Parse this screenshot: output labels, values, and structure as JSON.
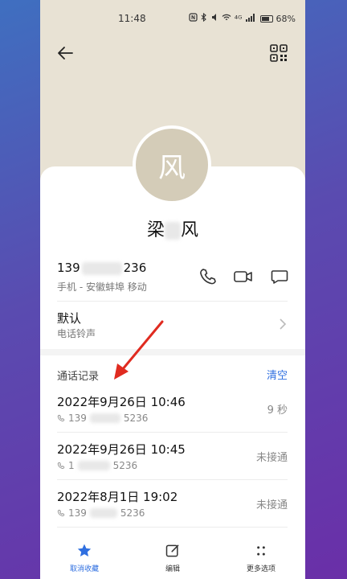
{
  "status_bar": {
    "time": "11:48",
    "signal_text": "⁴ᴳ",
    "battery": "68%"
  },
  "contact": {
    "avatar_letter": "风",
    "name_first": "梁",
    "name_last": "风"
  },
  "phone": {
    "prefix": "139",
    "suffix": "236",
    "subtitle": "手机 - 安徽蚌埠 移动"
  },
  "ringtone": {
    "title": "默认",
    "subtitle": "电话铃声"
  },
  "call_log": {
    "title": "通话记录",
    "clear_label": "清空",
    "entries": [
      {
        "date": "2022年9月26日 10:46",
        "num_prefix": "139",
        "num_suffix": "5236",
        "status": "9 秒"
      },
      {
        "date": "2022年9月26日 10:45",
        "num_prefix": "1",
        "num_suffix": "5236",
        "status": "未接通"
      },
      {
        "date": "2022年8月1日 19:02",
        "num_prefix": "139",
        "num_suffix": "5236",
        "status": "未接通"
      }
    ]
  },
  "bottom_nav": {
    "unfavorite": "取消收藏",
    "edit": "编辑",
    "more": "更多选项"
  },
  "colors": {
    "accent": "#2f6fe0",
    "header_bg": "#e8e2d4",
    "arrow": "#e02b20"
  }
}
